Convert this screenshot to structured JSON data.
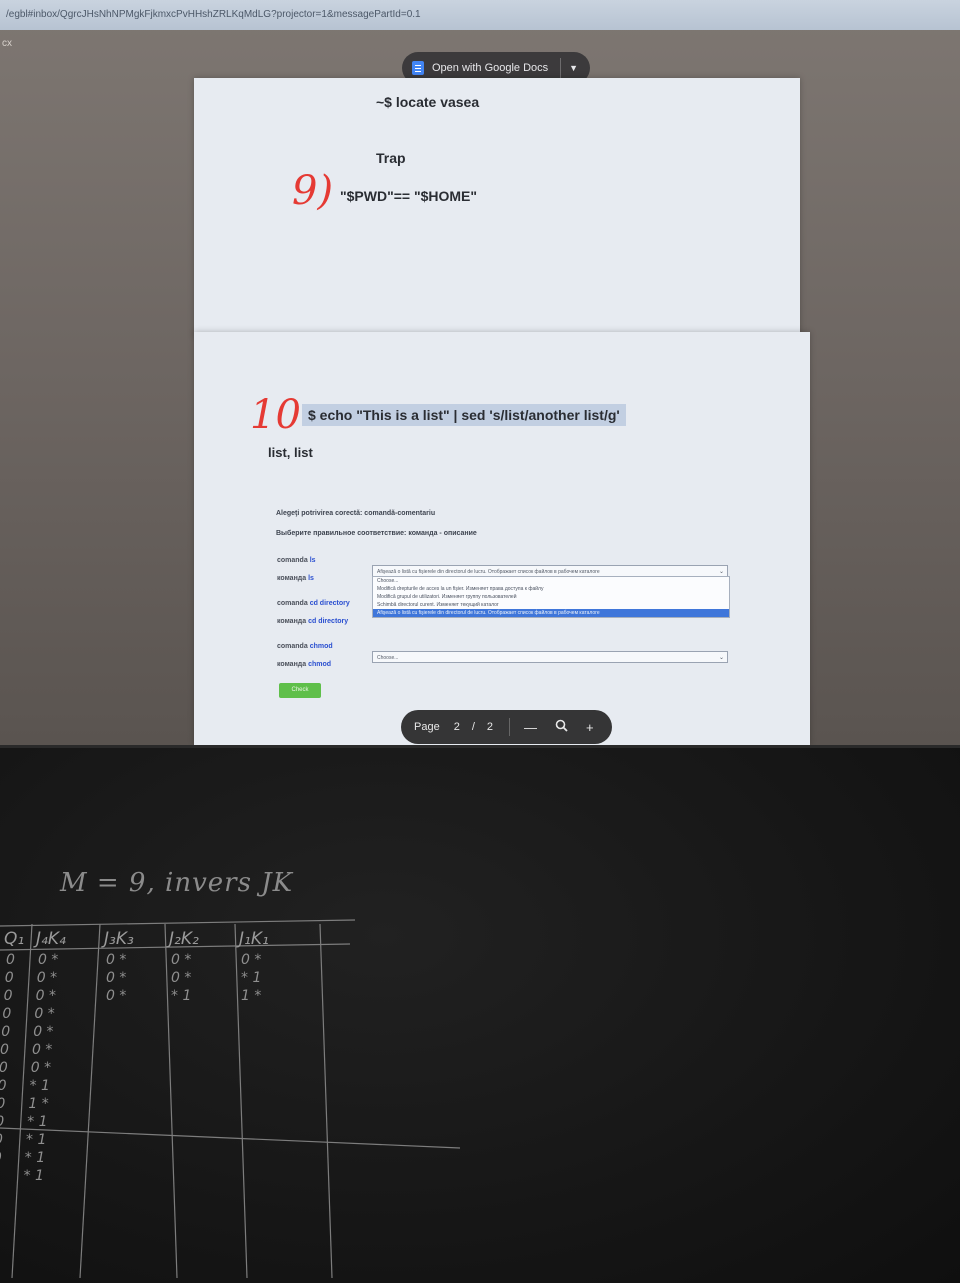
{
  "browser": {
    "url": "/egbl#inbox/QgrcJHsNhNPMgkFjkmxcPvHHshZRLKqMdLG?projector=1&messagePartId=0.1",
    "left_label": "cx"
  },
  "viewer_toolbar": {
    "open_with_label": "Open with Google Docs",
    "open_with_icon": "google-docs-icon",
    "dropdown_icon": "chevron-down-icon"
  },
  "page1": {
    "command": "~$ locate vasea",
    "trap": "Trap",
    "expression": "\"$PWD\"== \"$HOME\""
  },
  "page2": {
    "command": "$ echo \"This is a list\" | sed 's/list/another list/g'",
    "output": "list, list",
    "quiz": {
      "title_ro": "Alegeţi potrivirea corectă: comandă-comentariu",
      "title_ru": "Выберите правильное соответствие: команда - описание",
      "rows": [
        {
          "label_ro": "comanda ",
          "kw_ro": "ls",
          "label_ru": "команда ",
          "kw_ru": "ls"
        },
        {
          "label_ro": "comanda ",
          "kw_ro": "cd directory",
          "label_ru": "команда ",
          "kw_ru": "cd directory"
        },
        {
          "label_ro": "comanda ",
          "kw_ro": "chmod",
          "label_ru": "команда ",
          "kw_ru": "chmod"
        }
      ],
      "select1_value": "Afişează o listă cu fişierele din directorul de lucru. Отображает список файлов в рабочем каталоге",
      "dropdown_options": [
        "Choose...",
        "Modifică drepturile de acces la un fişier. Изменяет права доступа к файлу",
        "Modifică grupul de utilizatori. Изменяет группу пользователей",
        "Schimbă directorul curent. Изменяет текущий каталог",
        "Afişează o listă cu fişierele din directorul de lucru. Отображает список файлов в рабочем каталоге"
      ],
      "selected_option_index": 4,
      "select3_value": "Choose...",
      "check_label": "Check"
    }
  },
  "page_controls": {
    "page_label": "Page",
    "current_page": "2",
    "separator": "/",
    "total_pages": "2",
    "zoom_out": "—",
    "zoom_icon": "magnifier-icon",
    "zoom_in": "+"
  },
  "annotations": {
    "mark_9": "9)",
    "mark_10": "10"
  },
  "board": {
    "title": "M = 9, invers JK",
    "headers": [
      "Q₁",
      "J₄K₄",
      "J₃K₃",
      "J₂K₂",
      "J₁K₁"
    ],
    "rows": [
      [
        "0",
        "0 *",
        "0 *",
        "0 *",
        "0 *"
      ],
      [
        "0",
        "0 *",
        "0 *",
        "0 *",
        "* 1"
      ],
      [
        "0",
        "0 *",
        "0 *",
        "* 1",
        "1 *"
      ],
      [
        "0",
        "0 *",
        "",
        "",
        ""
      ],
      [
        "0",
        "0 *",
        "",
        "",
        ""
      ],
      [
        "0",
        "0 *",
        "",
        "",
        ""
      ],
      [
        "0",
        "0 *",
        "",
        "",
        ""
      ],
      [
        "0",
        "* 1",
        "",
        "",
        ""
      ],
      [
        "0",
        "1 *",
        "",
        "",
        ""
      ],
      [
        "0",
        "* 1",
        "",
        "",
        ""
      ],
      [
        "0",
        "* 1",
        "",
        "",
        ""
      ],
      [
        "0",
        "* 1",
        "",
        "",
        ""
      ],
      [
        "0",
        "* 1",
        "",
        "",
        ""
      ]
    ]
  }
}
